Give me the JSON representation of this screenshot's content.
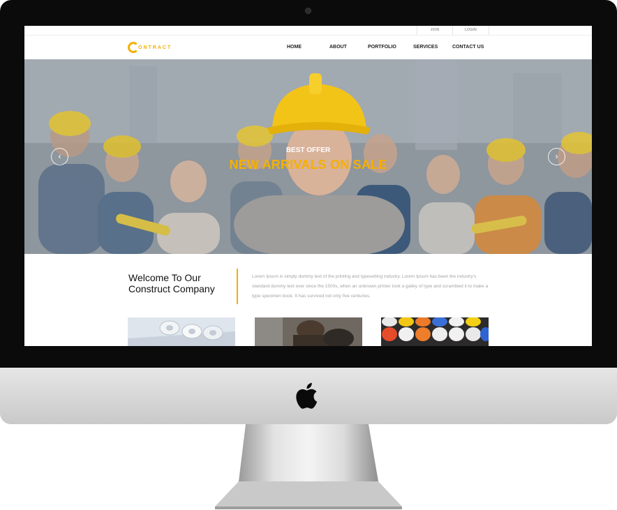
{
  "topbar": {
    "join_label": "JOIN",
    "login_label": "LOGIN"
  },
  "brand": {
    "name": "ONTRACT",
    "accent_color": "#f5b000"
  },
  "nav": [
    {
      "label": "HOME"
    },
    {
      "label": "ABOUT"
    },
    {
      "label": "PORTFOLIO"
    },
    {
      "label": "SERVICES"
    },
    {
      "label": "CONTACT US"
    }
  ],
  "hero": {
    "subtitle": "BEST OFFER",
    "title": "NEW ARRIVALS ON SALE",
    "prev_icon": "chevron-left-icon",
    "next_icon": "chevron-right-icon"
  },
  "welcome": {
    "heading_line1": "Welcome To Our",
    "heading_line2": "Construct Company",
    "body": "Lorem Ipsum is simply dummy text of the printing and typesetting industry. Lorem Ipsum has been the industry's standard dummy text ever since the 1500s, when an unknown printer took a galley of type and scrambled it to make a type specimen book. It has survived not only five centuries."
  }
}
